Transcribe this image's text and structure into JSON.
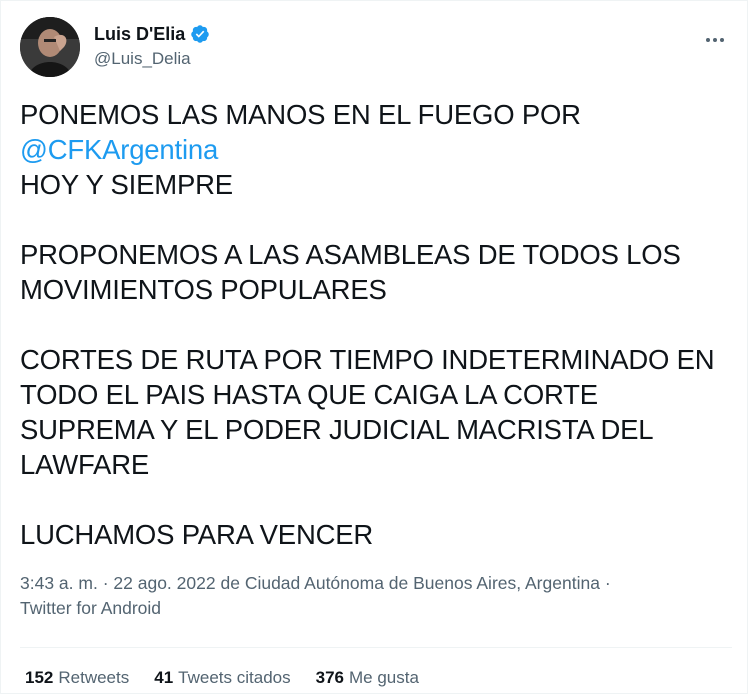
{
  "author": {
    "display_name": "Luis D'Elia",
    "handle": "@Luis_Delia",
    "verified_icon": "verified-badge-icon",
    "avatar_icon": "avatar-photo"
  },
  "tweet": {
    "line1": "PONEMOS LAS MANOS EN EL FUEGO POR",
    "mention": "@CFKArgentina",
    "line3": "HOY Y SIEMPRE",
    "para2": "PROPONEMOS A LAS ASAMBLEAS DE TODOS LOS MOVIMIENTOS POPULARES",
    "para3": "CORTES DE RUTA POR TIEMPO INDETERMINADO EN TODO EL PAIS HASTA QUE CAIGA LA CORTE SUPREMA Y EL PODER JUDICIAL MACRISTA DEL LAWFARE",
    "para4": "LUCHAMOS PARA VENCER"
  },
  "meta": {
    "time": "3:43 a. m.",
    "separator": "·",
    "date": "22 ago. 2022",
    "location_prefix": "de",
    "location": "Ciudad Autónoma de Buenos Aires, Argentina",
    "source": "Twitter for Android"
  },
  "stats": [
    {
      "count": "152",
      "label": "Retweets"
    },
    {
      "count": "41",
      "label": "Tweets citados"
    },
    {
      "count": "376",
      "label": "Me gusta"
    }
  ],
  "colors": {
    "link": "#1d9bf0",
    "text": "#0f1419",
    "secondary": "#536471",
    "divider": "#eff3f4"
  }
}
